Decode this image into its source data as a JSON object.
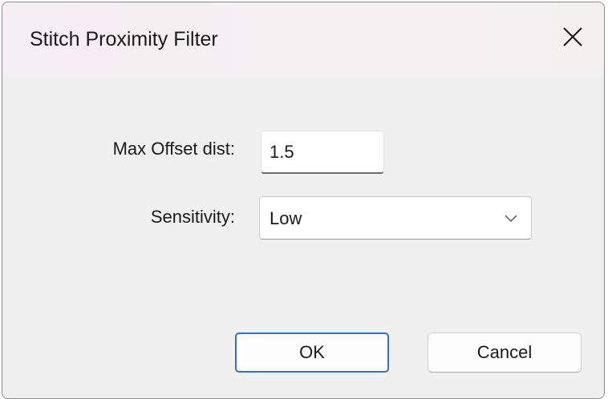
{
  "window": {
    "title": "Stitch Proximity Filter",
    "close_icon": "close-icon"
  },
  "form": {
    "max_offset": {
      "label": "Max Offset dist:",
      "value": "1.5"
    },
    "sensitivity": {
      "label": "Sensitivity:",
      "selected": "Low",
      "icon": "chevron-down-icon"
    }
  },
  "buttons": {
    "ok_label": "OK",
    "cancel_label": "Cancel"
  },
  "colors": {
    "accent": "#2f6fd0",
    "dialog_bg": "#f0f0f0",
    "titlebar_tint": "#f6eff2"
  }
}
